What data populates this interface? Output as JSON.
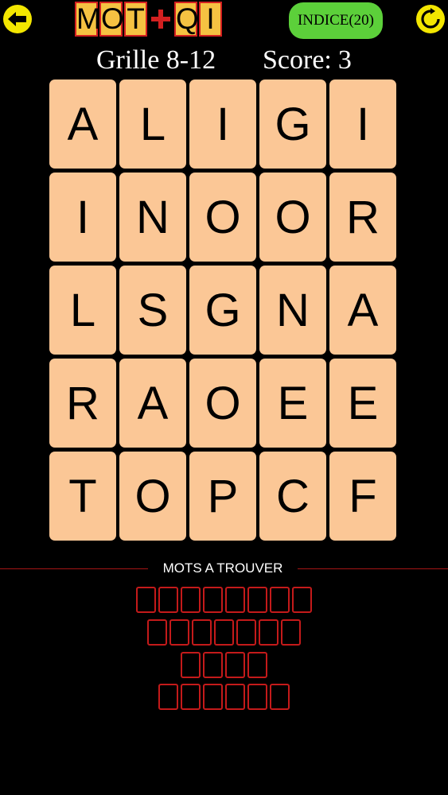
{
  "header": {
    "logo_letters_left": [
      "M",
      "O",
      "T"
    ],
    "logo_letters_right": [
      "Q",
      "I"
    ],
    "hint_label": "INDICE(20)",
    "grid_label": "Grille 8-12",
    "score_label": "Score:",
    "score_value": "3",
    "back_icon": "arrow-left-icon",
    "refresh_icon": "refresh-icon"
  },
  "colors": {
    "background": "#000000",
    "tile": "#fbc796",
    "accent_yellow": "#f3e600",
    "hint_green": "#5cd03a",
    "slot_red": "#c41a1a",
    "logo_tile": "#f5c242",
    "logo_plus": "#d32020"
  },
  "grid": {
    "rows": [
      [
        "A",
        "L",
        "I",
        "G",
        "I"
      ],
      [
        "I",
        "N",
        "O",
        "O",
        "R"
      ],
      [
        "L",
        "S",
        "G",
        "N",
        "A"
      ],
      [
        "R",
        "A",
        "O",
        "E",
        "E"
      ],
      [
        "T",
        "O",
        "P",
        "C",
        "F"
      ]
    ]
  },
  "words_section": {
    "title": "MOTS A TROUVER",
    "word_lengths": [
      8,
      7,
      4,
      6
    ]
  }
}
